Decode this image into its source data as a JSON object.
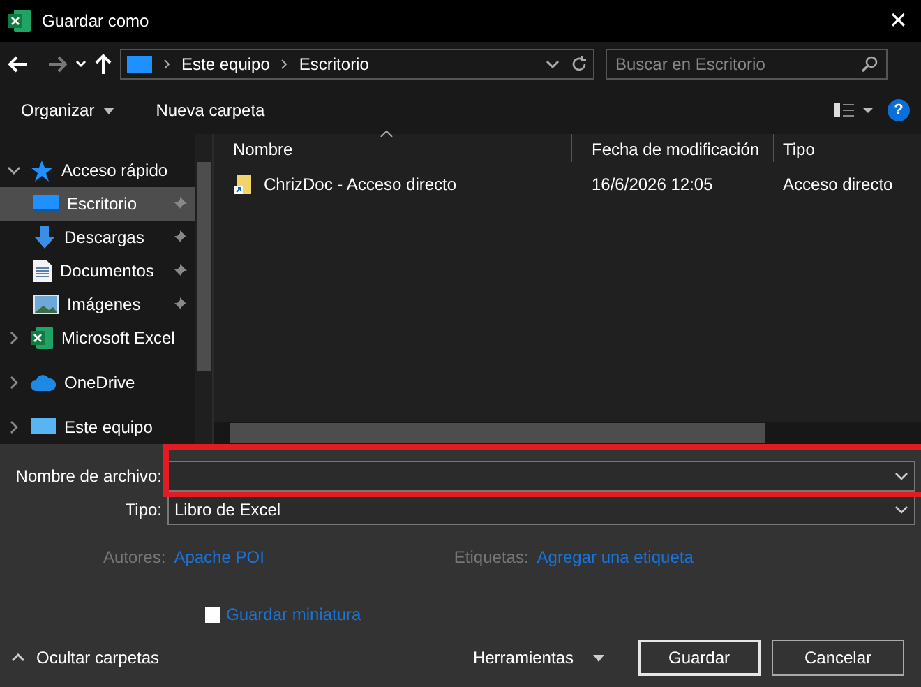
{
  "window": {
    "title": "Guardar como",
    "close": "✕"
  },
  "nav": {
    "path": [
      "Este equipo",
      "Escritorio"
    ],
    "search_placeholder": "Buscar en Escritorio"
  },
  "toolbar": {
    "organize": "Organizar",
    "new_folder": "Nueva carpeta",
    "help": "?"
  },
  "sidebar": {
    "items": [
      {
        "label": "Acceso rápido",
        "kind": "star",
        "expanded": true,
        "children": [
          {
            "label": "Escritorio",
            "kind": "desktop",
            "selected": true,
            "pinned": true
          },
          {
            "label": "Descargas",
            "kind": "download",
            "selected": false,
            "pinned": true
          },
          {
            "label": "Documentos",
            "kind": "document",
            "selected": false,
            "pinned": true
          },
          {
            "label": "Imágenes",
            "kind": "image",
            "selected": false,
            "pinned": true
          }
        ]
      },
      {
        "label": "Microsoft Excel",
        "kind": "excel",
        "expanded": false
      },
      {
        "label": "OneDrive",
        "kind": "cloud",
        "expanded": false
      },
      {
        "label": "Este equipo",
        "kind": "pc",
        "expanded": false
      }
    ]
  },
  "table": {
    "columns": [
      "Nombre",
      "Fecha de modificación",
      "Tipo"
    ],
    "rows": [
      {
        "name": "ChrizDoc - Acceso directo",
        "date": "16/6/2026 12:05",
        "type": "Acceso directo"
      }
    ]
  },
  "form": {
    "filename_label": "Nombre de archivo:",
    "type_label": "Tipo:",
    "type_value": "Libro de Excel",
    "authors_label": "Autores:",
    "authors_value": "Apache POI",
    "tags_label": "Etiquetas:",
    "tags_value": "Agregar una etiqueta",
    "thumbnail": {
      "label": "Guardar miniatura",
      "checked": false
    }
  },
  "footer": {
    "hide_folders": "Ocultar carpetas",
    "tools": "Herramientas",
    "buttons": [
      "Guardar",
      "Cancelar"
    ]
  }
}
